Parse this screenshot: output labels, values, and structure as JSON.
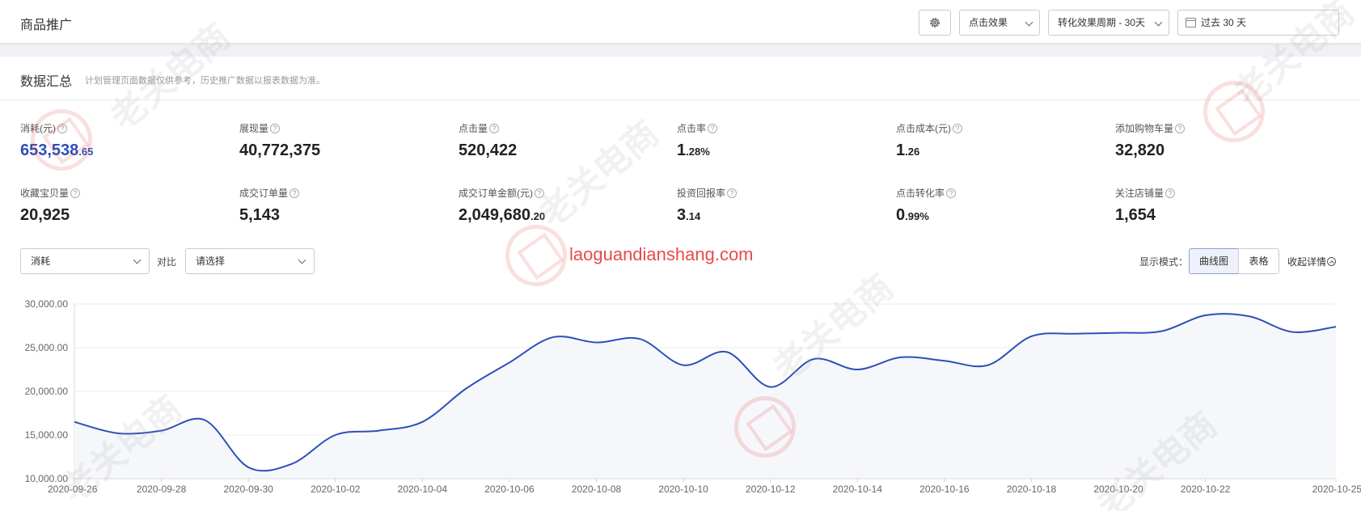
{
  "header": {
    "title": "商品推广",
    "effect_dropdown": "点击效果",
    "period_dropdown": "转化效果周期 - 30天",
    "date_range": "过去 30 天"
  },
  "summary": {
    "title": "数据汇总",
    "note": "计划管理页面数据仅供参考，历史推广数据以报表数据为准。",
    "metrics": [
      {
        "label": "消耗(元)",
        "int": "653,538",
        "dec": ".65"
      },
      {
        "label": "展现量",
        "int": "40,772,375",
        "dec": ""
      },
      {
        "label": "点击量",
        "int": "520,422",
        "dec": ""
      },
      {
        "label": "点击率",
        "int": "1",
        "dec": ".28%"
      },
      {
        "label": "点击成本(元)",
        "int": "1",
        "dec": ".26"
      },
      {
        "label": "添加购物车量",
        "int": "32,820",
        "dec": ""
      },
      {
        "label": "收藏宝贝量",
        "int": "20,925",
        "dec": ""
      },
      {
        "label": "成交订单量",
        "int": "5,143",
        "dec": ""
      },
      {
        "label": "成交订单金额(元)",
        "int": "2,049,680",
        "dec": ".20"
      },
      {
        "label": "投资回报率",
        "int": "3",
        "dec": ".14"
      },
      {
        "label": "点击转化率",
        "int": "0",
        "dec": ".99%"
      },
      {
        "label": "关注店铺量",
        "int": "1,654",
        "dec": ""
      }
    ]
  },
  "controls": {
    "metric_select": "消耗",
    "compare_label": "对比",
    "compare_select": "请选择",
    "mode_label": "显示模式：",
    "mode_curve": "曲线图",
    "mode_table": "表格",
    "collapse": "收起详情"
  },
  "watermark": {
    "site": "laoguandianshang.com",
    "text": "老关电商"
  },
  "colors": {
    "accent": "#2e4fb8",
    "line": "#2e4fb8",
    "area": "#f6f7fb",
    "watermark_red": "#e84a4a"
  },
  "icons": [
    "gear-icon",
    "chevron-down-icon",
    "calendar-icon",
    "help-icon",
    "collapse-up-icon"
  ],
  "chart_data": {
    "type": "area",
    "title": "",
    "xlabel": "",
    "ylabel": "",
    "ylim": [
      10000,
      30000
    ],
    "y_ticks": [
      "30,000.00",
      "25,000.00",
      "20,000.00",
      "15,000.00",
      "10,000.00"
    ],
    "grid": true,
    "x": [
      "2020-09-26",
      "2020-09-27",
      "2020-09-28",
      "2020-09-29",
      "2020-09-30",
      "2020-10-01",
      "2020-10-02",
      "2020-10-03",
      "2020-10-04",
      "2020-10-05",
      "2020-10-06",
      "2020-10-07",
      "2020-10-08",
      "2020-10-09",
      "2020-10-10",
      "2020-10-11",
      "2020-10-12",
      "2020-10-13",
      "2020-10-14",
      "2020-10-15",
      "2020-10-16",
      "2020-10-17",
      "2020-10-18",
      "2020-10-19",
      "2020-10-20",
      "2020-10-21",
      "2020-10-22",
      "2020-10-23",
      "2020-10-24",
      "2020-10-25"
    ],
    "x_tick_labels": [
      "2020-09-26",
      "2020-09-28",
      "2020-09-30",
      "2020-10-02",
      "2020-10-04",
      "2020-10-06",
      "2020-10-08",
      "2020-10-10",
      "2020-10-12",
      "2020-10-14",
      "2020-10-16",
      "2020-10-18",
      "2020-10-20",
      "2020-10-22",
      "2020-10-25"
    ],
    "series": [
      {
        "values": [
          16500,
          15200,
          15500,
          16700,
          11300,
          11700,
          15000,
          15500,
          16500,
          20300,
          23300,
          26200,
          25600,
          26000,
          23000,
          24500,
          20500,
          23700,
          22500,
          23900,
          23500,
          23000,
          26300,
          26600,
          26700,
          26900,
          28700,
          28600,
          26800,
          27400
        ]
      }
    ]
  }
}
